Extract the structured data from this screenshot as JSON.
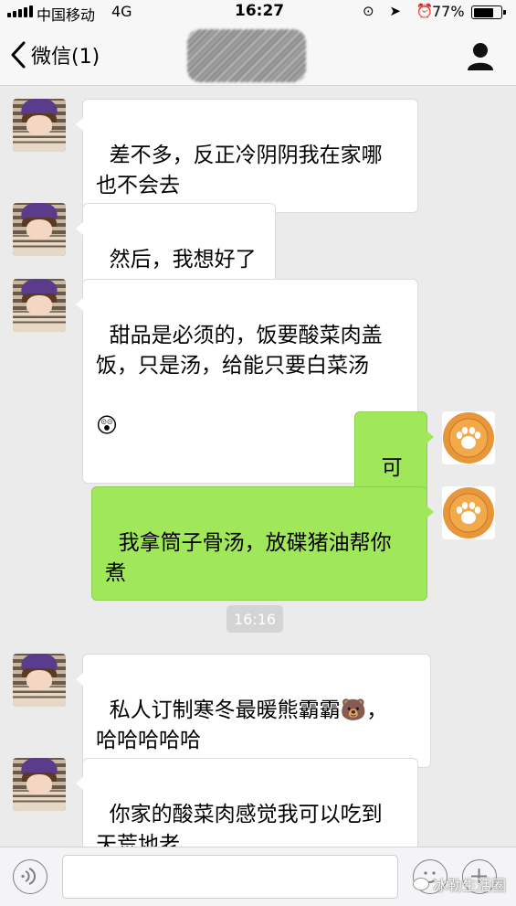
{
  "status_bar": {
    "carrier": "中国移动",
    "network": "4G",
    "time": "16:27",
    "icons": "⊙ ➤ ⏰",
    "battery_percent": "77%",
    "battery_level": 0.77
  },
  "nav": {
    "back_label": "微信(1)"
  },
  "messages": [
    {
      "side": "in",
      "text": "差不多，反正冷阴阴我在家哪\n也不会去"
    },
    {
      "side": "in",
      "text": "然后，我想好了"
    },
    {
      "side": "in",
      "text": "甜品是必须的，饭要酸菜肉盖\n饭，只是汤，给能只要白菜汤",
      "emoji": "😲"
    },
    {
      "side": "out",
      "text": "可以"
    },
    {
      "side": "out",
      "text": "我拿筒子骨汤，放碟猪油帮你\n煮"
    },
    {
      "side": "in",
      "text": "私人订制寒冬最暖熊霸霸",
      "emoji": "🐻",
      "text_after": "，\n哈哈哈哈哈"
    },
    {
      "side": "in",
      "text": "你家的酸菜肉感觉我可以吃到\n天荒地老"
    }
  ],
  "timestamp": "16:16",
  "watermark": "冰勒生活圈",
  "colors": {
    "background": "#ebebeb",
    "outgoing_bubble": "#a0e75a",
    "incoming_bubble": "#ffffff",
    "paw_avatar": "#e8963a"
  }
}
